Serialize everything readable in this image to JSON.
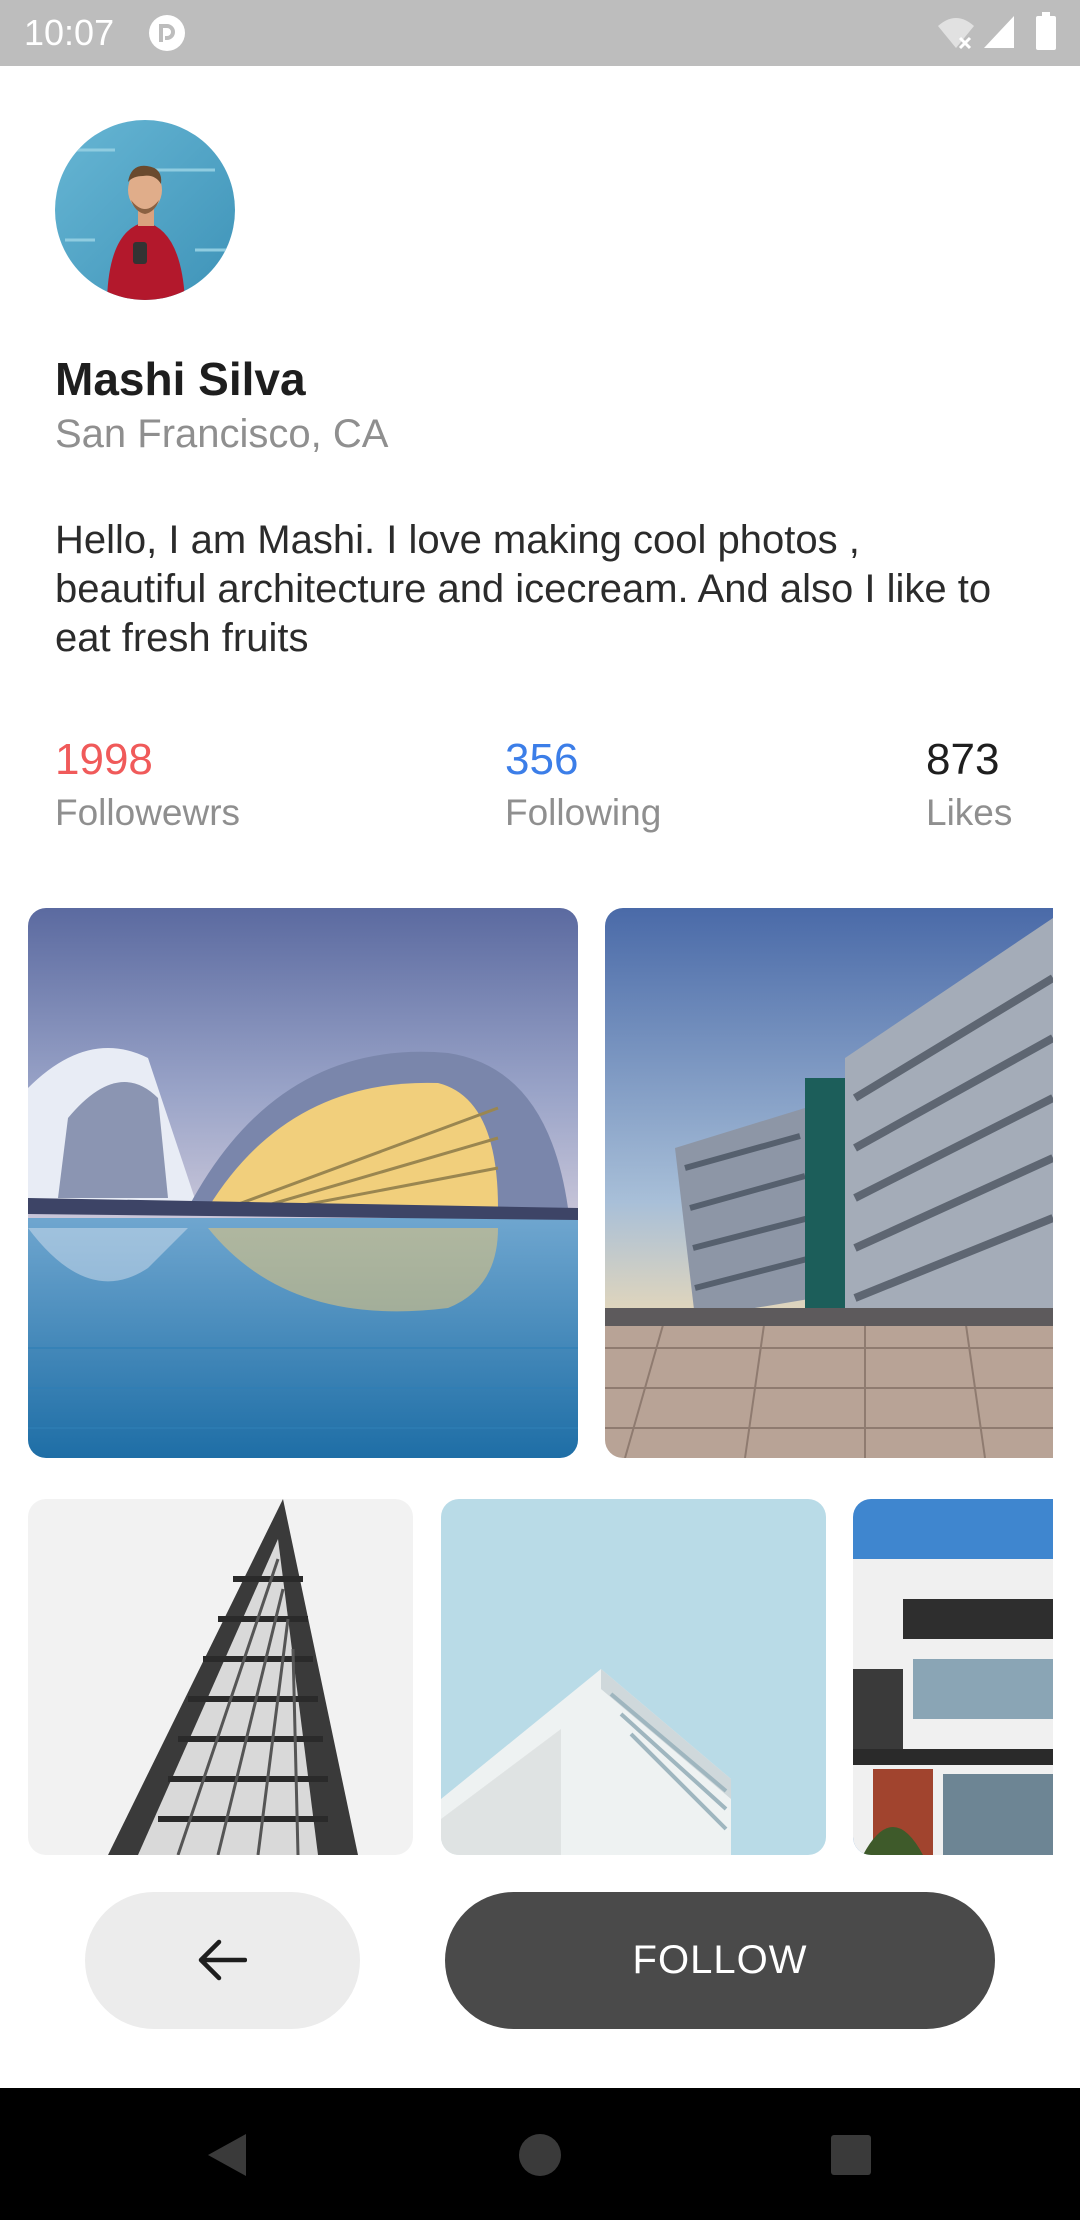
{
  "status_bar": {
    "time": "10:07",
    "icons": [
      "app-notification-icon",
      "wifi-off-icon",
      "cellular-signal-icon",
      "battery-icon"
    ]
  },
  "profile": {
    "name": "Mashi Silva",
    "location": "San Francisco, CA",
    "bio": "Hello, I am Mashi. I love making cool photos , beautiful architecture and icecream. And also I like to eat fresh fruits"
  },
  "stats": {
    "followers": {
      "value": "1998",
      "label": "Followewrs",
      "color": "#f05a5a"
    },
    "following": {
      "value": "356",
      "label": "Following",
      "color": "#3c7ee8"
    },
    "likes": {
      "value": "873",
      "label": "Likes",
      "color": "#1e1e1e"
    }
  },
  "photos": [
    {
      "subject": "futuristic glass dome building reflected in water"
    },
    {
      "subject": "angular metallic building facade"
    },
    {
      "subject": "flatiron style tower looking up"
    },
    {
      "subject": "white modern building against pale blue sky"
    },
    {
      "subject": "modern residential house"
    }
  ],
  "actions": {
    "back_icon": "arrow-left-icon",
    "follow_label": "FOLLOW"
  },
  "nav_bar": {
    "icons": [
      "nav-back-icon",
      "nav-home-icon",
      "nav-recents-icon"
    ]
  }
}
